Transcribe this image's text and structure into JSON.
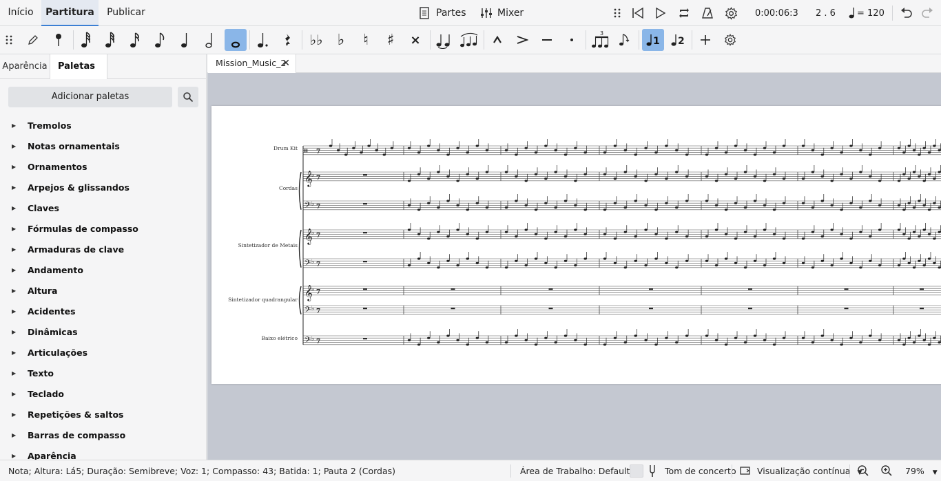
{
  "menu": {
    "home": "Início",
    "score": "Partitura",
    "publish": "Publicar"
  },
  "toolbar": {
    "parts_label": "Partes",
    "mixer_label": "Mixer",
    "time": "0:00:06:3",
    "position": "2 . 6",
    "tempo": "= 120"
  },
  "note_toolbar": {
    "icons": [
      "drag-handle-icon",
      "pencil-icon",
      "pin-icon",
      "64th-note-icon",
      "32nd-note-icon",
      "16th-note-icon",
      "eighth-note-icon",
      "quarter-note-icon",
      "half-note-icon",
      "whole-note-icon",
      "dot-icon",
      "rest-icon",
      "double-flat-icon",
      "flat-icon",
      "natural-icon",
      "sharp-icon",
      "double-sharp-icon",
      "tie-icon",
      "slur-icon",
      "marcato-icon",
      "accent-icon",
      "tenuto-icon",
      "staccato-icon",
      "tuplet-icon",
      "flip-icon",
      "voice-1-icon",
      "voice-2-icon",
      "add-icon",
      "settings-icon"
    ]
  },
  "left_panel": {
    "tab_appearance": "Aparência",
    "tab_palettes": "Paletas",
    "more": "···",
    "add_palettes": "Adicionar paletas",
    "palettes": [
      "Tremolos",
      "Notas ornamentais",
      "Ornamentos",
      "Arpejos & glissandos",
      "Claves",
      "Fórmulas de compasso",
      "Armaduras de clave",
      "Andamento",
      "Altura",
      "Acidentes",
      "Dinâmicas",
      "Articulações",
      "Texto",
      "Teclado",
      "Repetições & saltos",
      "Barras de compasso",
      "Aparência"
    ]
  },
  "score": {
    "doc_tab": "Mission_Music_2",
    "instruments": [
      "Drum Kit",
      "Cordas",
      "Sintetizador de Metais",
      "Sintetizador quadrangular",
      "Baixo elétrico"
    ]
  },
  "status": {
    "selection": "Nota; Altura: Lá5; Duração: Semibreve; Voz: 1; Compasso: 43; Batida: 1; Pauta 2 (Cordas)",
    "workspace": "Área de Trabalho: Default",
    "concert_pitch": "Tom de concerto",
    "view_mode": "Visualização contínua",
    "zoom": "79%"
  },
  "colors": {
    "accent": "#3b7fd4",
    "active_button": "#8ab6e8",
    "score_bg": "#c4c8d1"
  }
}
